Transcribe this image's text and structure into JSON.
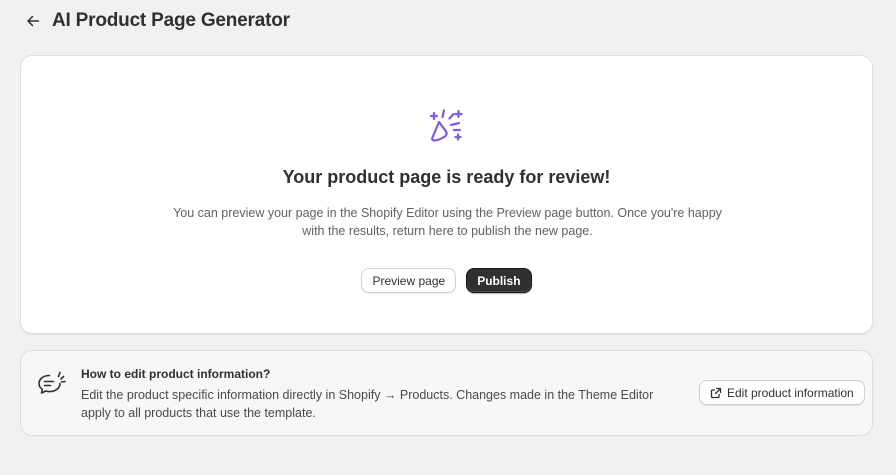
{
  "header": {
    "title": "AI Product Page Generator"
  },
  "review_card": {
    "heading": "Your product page is ready for review!",
    "body": "You can preview your page in the Shopify Editor using the Preview page button. Once you're happy with the results, return here to publish the new page.",
    "preview_label": "Preview page",
    "publish_label": "Publish",
    "icon": "party-popper-icon"
  },
  "info_card": {
    "title": "How to edit product information?",
    "body": "Edit the product specific information directly in Shopify → Products. Changes made in the Theme Editor apply to all products that use the template.",
    "button_label": "Edit product information",
    "icon": "chat-sparkle-icon",
    "button_icon": "external-link-icon"
  },
  "colors": {
    "accent": "#7a5af8",
    "primary_button": "#303030",
    "background": "#f1f1f1"
  }
}
